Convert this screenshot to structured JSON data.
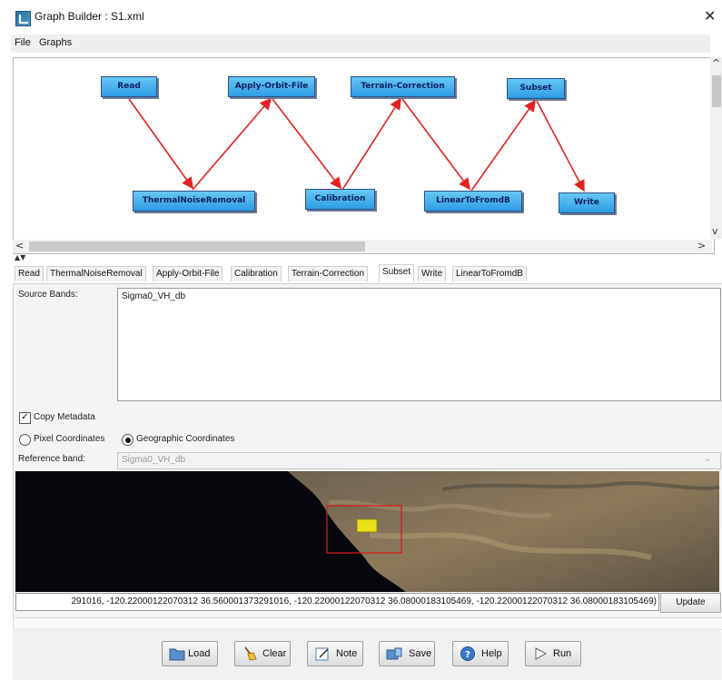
{
  "window": {
    "title": "Graph Builder : S1.xml",
    "close_glyph": "✕"
  },
  "menu": [
    "File",
    "Graphs"
  ],
  "graph": {
    "nodes": [
      {
        "id": "read",
        "label": "Read"
      },
      {
        "id": "apply-orbit-file",
        "label": "Apply-Orbit-File"
      },
      {
        "id": "terrain-correction",
        "label": "Terrain-Correction"
      },
      {
        "id": "subset",
        "label": "Subset"
      },
      {
        "id": "thermal-noise-removal",
        "label": "ThermalNoiseRemoval"
      },
      {
        "id": "calibration",
        "label": "Calibration"
      },
      {
        "id": "linear-to-fromdb",
        "label": "LinearToFromdB"
      },
      {
        "id": "write",
        "label": "Write"
      }
    ],
    "edge_color": "#e32020"
  },
  "tabs": [
    {
      "label": "Read",
      "active": false
    },
    {
      "label": "ThermalNoiseRemoval",
      "active": false
    },
    {
      "label": "Apply-Orbit-File",
      "active": false
    },
    {
      "label": "Calibration",
      "active": false
    },
    {
      "label": "Terrain-Correction",
      "active": false
    },
    {
      "label": "Subset",
      "active": true
    },
    {
      "label": "Write",
      "active": false
    },
    {
      "label": "LinearToFromdB",
      "active": false
    }
  ],
  "subset": {
    "source_bands_label": "Source Bands:",
    "source_bands": [
      "Sigma0_VH_db"
    ],
    "copy_metadata_label": "Copy Metadata",
    "copy_metadata_checked": true,
    "pixel_coordinates_label": "Pixel Coordinates",
    "geographic_coordinates_label": "Geographic Coordinates",
    "selected_coordinates": "geographic",
    "reference_band_label": "Reference band:",
    "reference_band_value": "Sigma0_VH_db",
    "geo_region": "291016, -120.22000122070312 36.560001373291016, -120.22000122070312 36.08000183105469, -120.22000122070312 36.08000183105469)",
    "update_label": "Update"
  },
  "buttons": [
    {
      "id": "load",
      "label": "Load",
      "icon": "folder-icon"
    },
    {
      "id": "clear",
      "label": "Clear",
      "icon": "broom-icon"
    },
    {
      "id": "note",
      "label": "Note",
      "icon": "note-icon"
    },
    {
      "id": "save",
      "label": "Save",
      "icon": "save-icon"
    },
    {
      "id": "help",
      "label": "Help",
      "icon": "help-icon"
    },
    {
      "id": "run",
      "label": "Run",
      "icon": "play-icon"
    }
  ],
  "colors": {
    "node_fill": "#3fa9ee",
    "selection_box": "#d41b1b",
    "subset_box": "#e8e21a"
  }
}
